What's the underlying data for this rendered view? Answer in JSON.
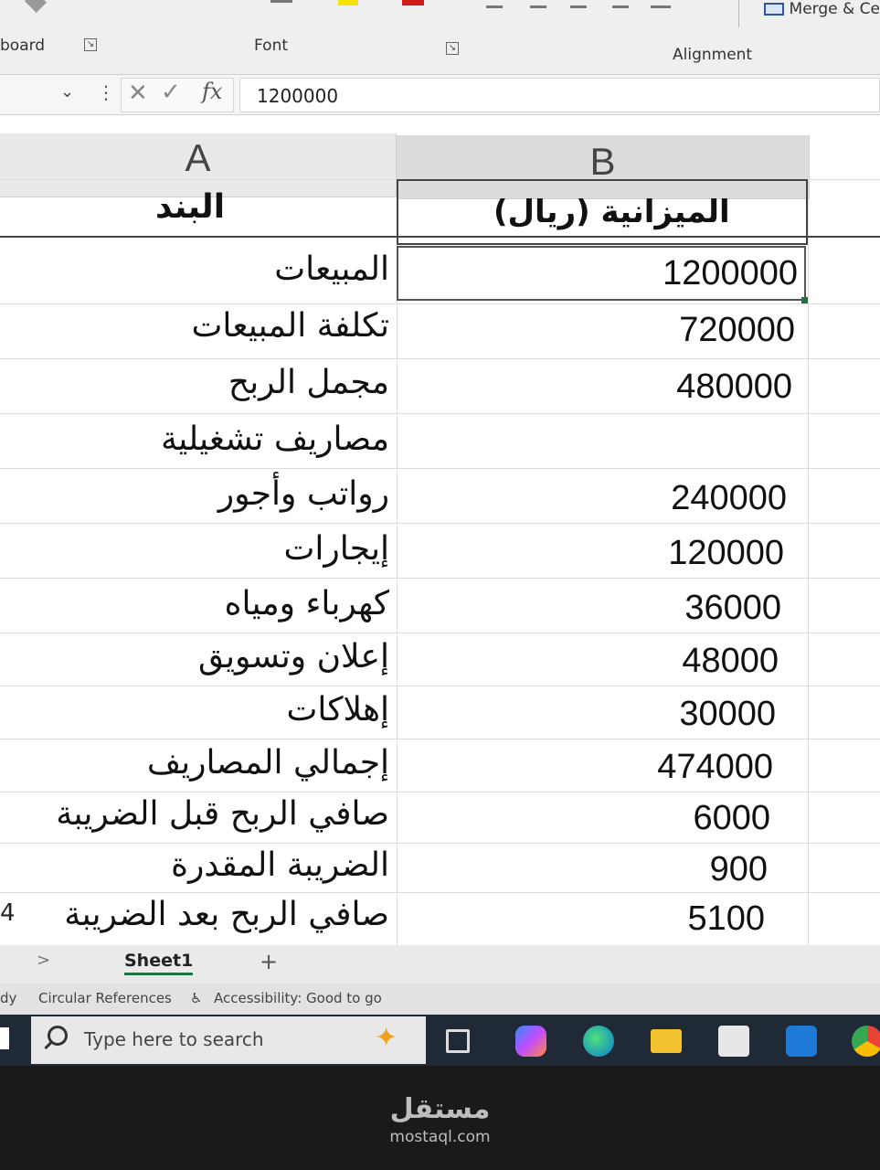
{
  "ribbon": {
    "clipboard_label": "board",
    "font_label": "Font",
    "alignment_label": "Alignment",
    "merge_label": "Merge & Ce"
  },
  "formula_bar": {
    "fx": "fx",
    "value": "1200000"
  },
  "sheet": {
    "col_a": "A",
    "col_b": "B",
    "header_a": "البند",
    "header_b": "الميزانية (ريال)",
    "rows": [
      {
        "item": "المبيعات",
        "value": "1200000"
      },
      {
        "item": "تكلفة المبيعات",
        "value": "720000"
      },
      {
        "item": "مجمل الربح",
        "value": "480000"
      },
      {
        "item": "مصاريف تشغيلية",
        "value": ""
      },
      {
        "item": "رواتب وأجور",
        "value": "240000"
      },
      {
        "item": "إيجارات",
        "value": "120000"
      },
      {
        "item": "كهرباء ومياه",
        "value": "36000"
      },
      {
        "item": "إعلان وتسويق",
        "value": "48000"
      },
      {
        "item": "إهلاكات",
        "value": "30000"
      },
      {
        "item": "إجمالي المصاريف",
        "value": "474000"
      },
      {
        "item": "صافي الربح قبل الضريبة",
        "value": "6000"
      },
      {
        "item": "الضريبة المقدرة",
        "value": "900"
      },
      {
        "item": "صافي الربح بعد الضريبة",
        "value": "5100"
      }
    ],
    "row_number_last": "4"
  },
  "tabs": {
    "nav": ">",
    "sheet1": "Sheet1",
    "add": "+"
  },
  "status": {
    "ready": "dy",
    "circular": "Circular References",
    "accessibility": "Accessibility: Good to go"
  },
  "taskbar": {
    "search_placeholder": "Type here to search"
  },
  "watermark": {
    "arabic": "مستقل",
    "url": "mostaql.com"
  }
}
